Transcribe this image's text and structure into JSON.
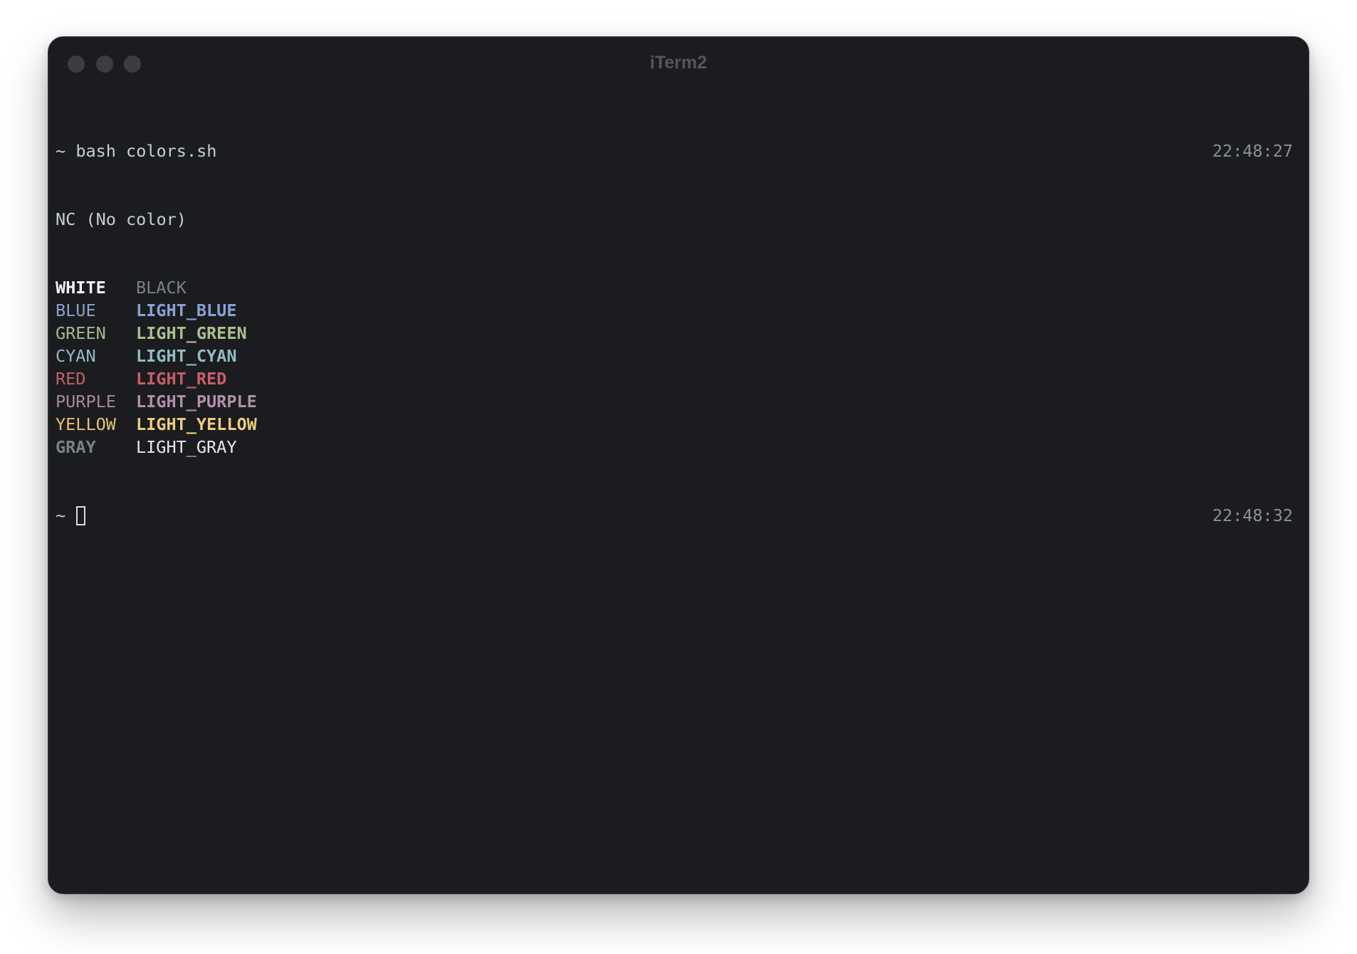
{
  "window": {
    "title": "iTerm2"
  },
  "terminal": {
    "command_line": {
      "prompt": "~",
      "command": "bash colors.sh",
      "timestamp": "22:48:27"
    },
    "nc_line": "NC (No color)",
    "rows": [
      {
        "left": "WHITE",
        "left_color": "#f2f3f5",
        "left_bold": true,
        "right": "BLACK",
        "right_color": "#7d8086",
        "right_bold": false
      },
      {
        "left": "BLUE",
        "left_color": "#8aa3c8",
        "left_bold": false,
        "right": "LIGHT_BLUE",
        "right_color": "#8aa3d0",
        "right_bold": true
      },
      {
        "left": "GREEN",
        "left_color": "#a3b98a",
        "left_bold": false,
        "right": "LIGHT_GREEN",
        "right_color": "#a9c08c",
        "right_bold": true
      },
      {
        "left": "CYAN",
        "left_color": "#93b9c6",
        "left_bold": false,
        "right": "LIGHT_CYAN",
        "right_color": "#93bcc4",
        "right_bold": true
      },
      {
        "left": "RED",
        "left_color": "#c0616a",
        "left_bold": false,
        "right": "LIGHT_RED",
        "right_color": "#c85e67",
        "right_bold": true
      },
      {
        "left": "PURPLE",
        "left_color": "#a8879e",
        "left_bold": false,
        "right": "LIGHT_PURPLE",
        "right_color": "#b38ea8",
        "right_bold": true
      },
      {
        "left": "YELLOW",
        "left_color": "#e7c173",
        "left_bold": false,
        "right": "LIGHT_YELLOW",
        "right_color": "#eccb7e",
        "right_bold": true
      },
      {
        "left": "GRAY",
        "left_color": "#7d8086",
        "left_bold": true,
        "right": "LIGHT_GRAY",
        "right_color": "#e6e8eb",
        "right_bold": false
      }
    ],
    "prompt_line": {
      "prompt": "~",
      "timestamp": "22:48:32"
    }
  }
}
